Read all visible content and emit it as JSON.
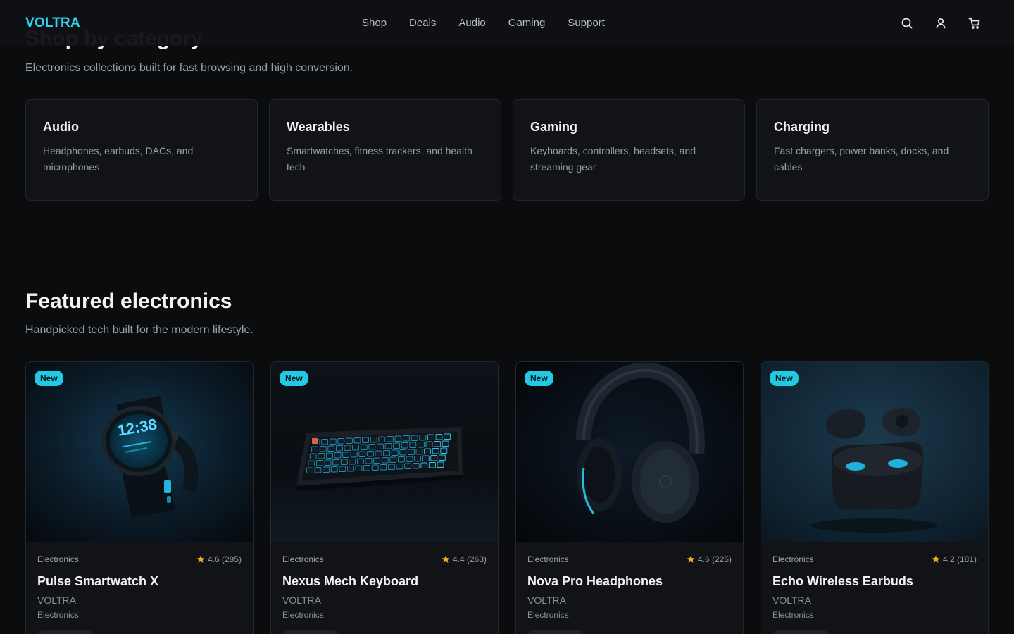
{
  "header": {
    "logo": "VOLTRA",
    "nav": [
      "Shop",
      "Deals",
      "Audio",
      "Gaming",
      "Support"
    ],
    "icons": [
      "search-icon",
      "user-icon",
      "cart-icon"
    ]
  },
  "categories_section": {
    "title": "Shop by category",
    "subtitle": "Electronics collections built for fast browsing and high conversion.",
    "items": [
      {
        "title": "Audio",
        "desc": "Headphones, earbuds, DACs, and microphones"
      },
      {
        "title": "Wearables",
        "desc": "Smartwatches, fitness trackers, and health tech"
      },
      {
        "title": "Gaming",
        "desc": "Keyboards, controllers, headsets, and streaming gear"
      },
      {
        "title": "Charging",
        "desc": "Fast chargers, power banks, docks, and cables"
      }
    ]
  },
  "featured_section": {
    "title": "Featured electronics",
    "subtitle": "Handpicked tech built for the modern lifestyle.",
    "products": [
      {
        "badge": "New",
        "category": "Electronics",
        "rating": "4.6 (285)",
        "name": "Pulse Smartwatch X",
        "brand": "VOLTRA",
        "subcategory": "Electronics",
        "image": "smartwatch"
      },
      {
        "badge": "New",
        "category": "Electronics",
        "rating": "4.4 (263)",
        "name": "Nexus Mech Keyboard",
        "brand": "VOLTRA",
        "subcategory": "Electronics",
        "image": "keyboard"
      },
      {
        "badge": "New",
        "category": "Electronics",
        "rating": "4.6 (225)",
        "name": "Nova Pro Headphones",
        "brand": "VOLTRA",
        "subcategory": "Electronics",
        "image": "headphones"
      },
      {
        "badge": "New",
        "category": "Electronics",
        "rating": "4.2 (181)",
        "name": "Echo Wireless Earbuds",
        "brand": "VOLTRA",
        "subcategory": "Electronics",
        "image": "earbuds"
      }
    ]
  },
  "colors": {
    "accent": "#2ad3ee",
    "badge": "#22c9e3",
    "star": "#f5b417",
    "background": "#0b0c0e",
    "card": "#111317"
  },
  "watch_display": "12:38"
}
